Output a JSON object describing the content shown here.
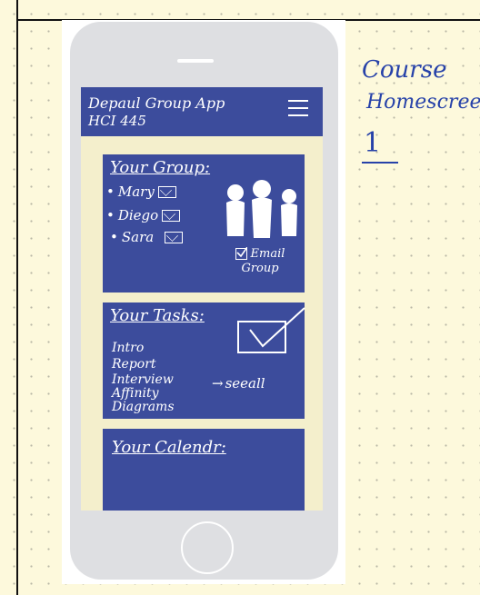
{
  "header": {
    "title": "Depaul Group App",
    "subtitle": "HCI 445"
  },
  "group_card": {
    "title": "Your Group:",
    "members": [
      "Mary",
      "Diego",
      "Sara"
    ],
    "email_group_label": "Email Group"
  },
  "tasks_card": {
    "title": "Your Tasks:",
    "items": [
      "Intro",
      "Report",
      "Interview",
      "Affinity Diagrams"
    ],
    "see_all": "seeall"
  },
  "calendar_card": {
    "title": "Your Calendr:"
  },
  "annotation": {
    "line1": "Course",
    "line2": "Homescreen",
    "line3": "1"
  },
  "colors": {
    "card": "#3c4c9c",
    "paper": "#fdf9dc",
    "ink": "#2742a9"
  }
}
